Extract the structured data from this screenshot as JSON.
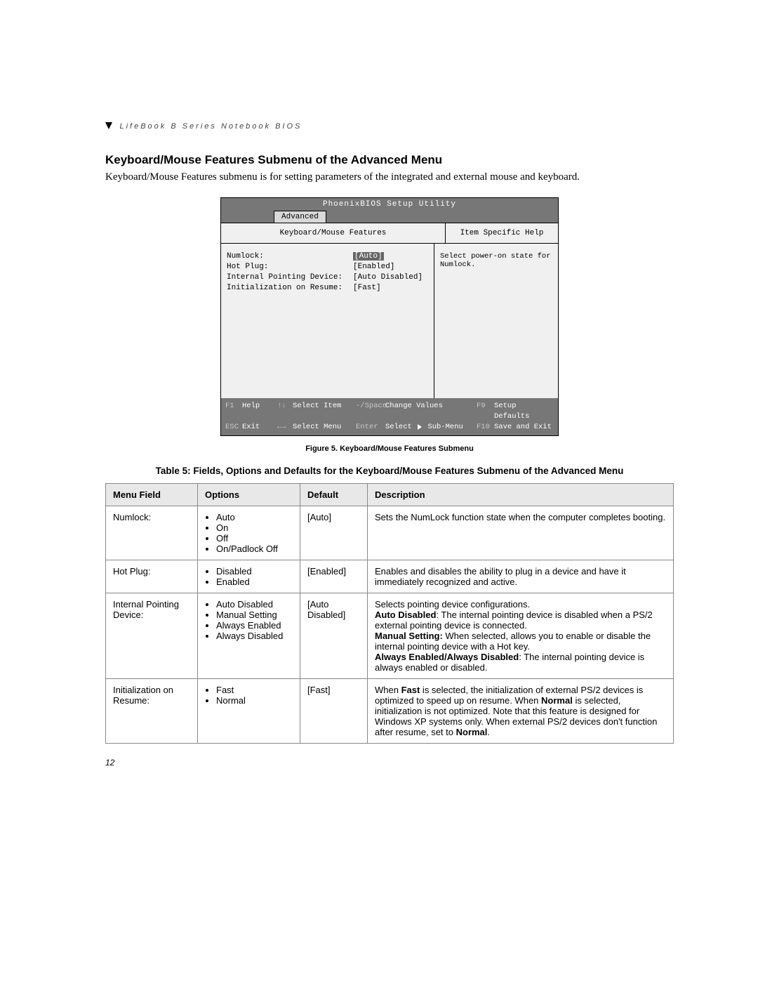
{
  "header": "LifeBook B Series Notebook BIOS",
  "section_title": "Keyboard/Mouse Features Submenu of the Advanced Menu",
  "intro": "Keyboard/Mouse Features submenu is for setting parameters of the integrated and external mouse and keyboard.",
  "bios": {
    "title": "PhoenixBIOS Setup Utility",
    "tab": "Advanced",
    "subheader_left": "Keyboard/Mouse Features",
    "subheader_right": "Item Specific Help",
    "rows": [
      {
        "label": "Numlock:",
        "value": "[Auto]",
        "hl": true
      },
      {
        "label": "Hot Plug:",
        "value": "[Enabled]",
        "hl": false
      },
      {
        "label": "Internal Pointing Device:",
        "value": "[Auto Disabled]",
        "hl": false
      },
      {
        "label": "Initialization on Resume:",
        "value": "[Fast]",
        "hl": false
      }
    ],
    "help_text": "Select power-on state for Numlock.",
    "footer": {
      "f1": "F1",
      "f1_label": "Help",
      "updown": "↑↓",
      "updown_label": "Select Item",
      "minus": "-/Space",
      "minus_label": "Change Values",
      "f9": "F9",
      "f9_label": "Setup Defaults",
      "esc": "ESC",
      "esc_label": "Exit",
      "leftright": "←→",
      "leftright_label": "Select Menu",
      "enter": "Enter",
      "enter_label": "Select ▶ Sub-Menu",
      "f10": "F10",
      "f10_label": "Save and Exit"
    }
  },
  "figure_caption": "Figure 5.  Keyboard/Mouse Features Submenu",
  "table_title": "Table 5: Fields, Options and Defaults for the Keyboard/Mouse Features Submenu of the Advanced Menu",
  "table": {
    "headers": [
      "Menu Field",
      "Options",
      "Default",
      "Description"
    ],
    "rows": [
      {
        "field": "Numlock:",
        "options": [
          "Auto",
          "On",
          "Off",
          "On/Padlock Off"
        ],
        "def": "[Auto]",
        "desc_plain": "Sets the NumLock function state when the computer completes booting."
      },
      {
        "field": "Hot Plug:",
        "options": [
          "Disabled",
          "Enabled"
        ],
        "def": "[Enabled]",
        "desc_plain": "Enables and disables the ability to plug in a device and have it immediately recognized and active."
      },
      {
        "field": "Internal Pointing Device:",
        "options": [
          "Auto Disabled",
          "Manual Setting",
          "Always Enabled",
          "Always Disabled"
        ],
        "def": "[Auto Disabled]",
        "desc_parts": {
          "p1": "Selects pointing device configurations.",
          "b1": "Auto Disabled",
          "t1": ":  The internal pointing device is disabled when a PS/2 external pointing device is connected.",
          "b2": "Manual Setting:",
          "t2": " When selected, allows you to enable or disable the internal pointing device with a Hot key.",
          "b3": "Always Enabled/Always Disabled",
          "t3": ": The internal pointing device is always enabled or disabled."
        }
      },
      {
        "field": "Initialization on Resume:",
        "options": [
          "Fast",
          "Normal"
        ],
        "def": "[Fast]",
        "desc_parts": {
          "p1": "When ",
          "b1": "Fast",
          "t1": " is selected, the initialization of external PS/2 devices is optimized to speed up on resume. When ",
          "b2": "Normal",
          "t2": " is selected, initialization is not optimized. Note that this feature is designed for Windows XP systems only. When external PS/2 devices don't function after resume, set to ",
          "b3": "Normal",
          "t3": "."
        }
      }
    ]
  },
  "page_number": "12"
}
